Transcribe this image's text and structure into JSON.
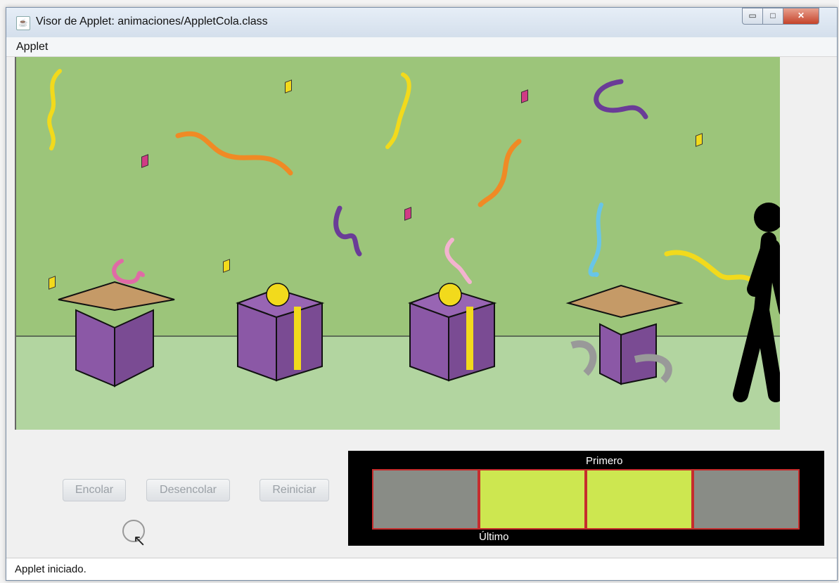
{
  "window": {
    "title": "Visor de Applet: animaciones/AppletCola.class"
  },
  "menu": {
    "items": [
      "Applet"
    ]
  },
  "buttons": {
    "encolar": "Encolar",
    "desencolar": "Desencolar",
    "reiniciar": "Reiniciar"
  },
  "queue": {
    "first_label": "Primero",
    "last_label": "Último",
    "cells": [
      {
        "state": "empty",
        "color": "#898c86"
      },
      {
        "state": "filled",
        "color": "#cde750"
      },
      {
        "state": "filled",
        "color": "#cde750"
      },
      {
        "state": "empty",
        "color": "#898c86"
      }
    ]
  },
  "status": {
    "text": "Applet iniciado."
  },
  "colors": {
    "scene_wall": "#9cc57a",
    "scene_floor": "#b2d5a0",
    "gift_purple": "#8b58a6",
    "gift_dots": "#b7d34f",
    "ribbon_yellow": "#f2da1c"
  }
}
